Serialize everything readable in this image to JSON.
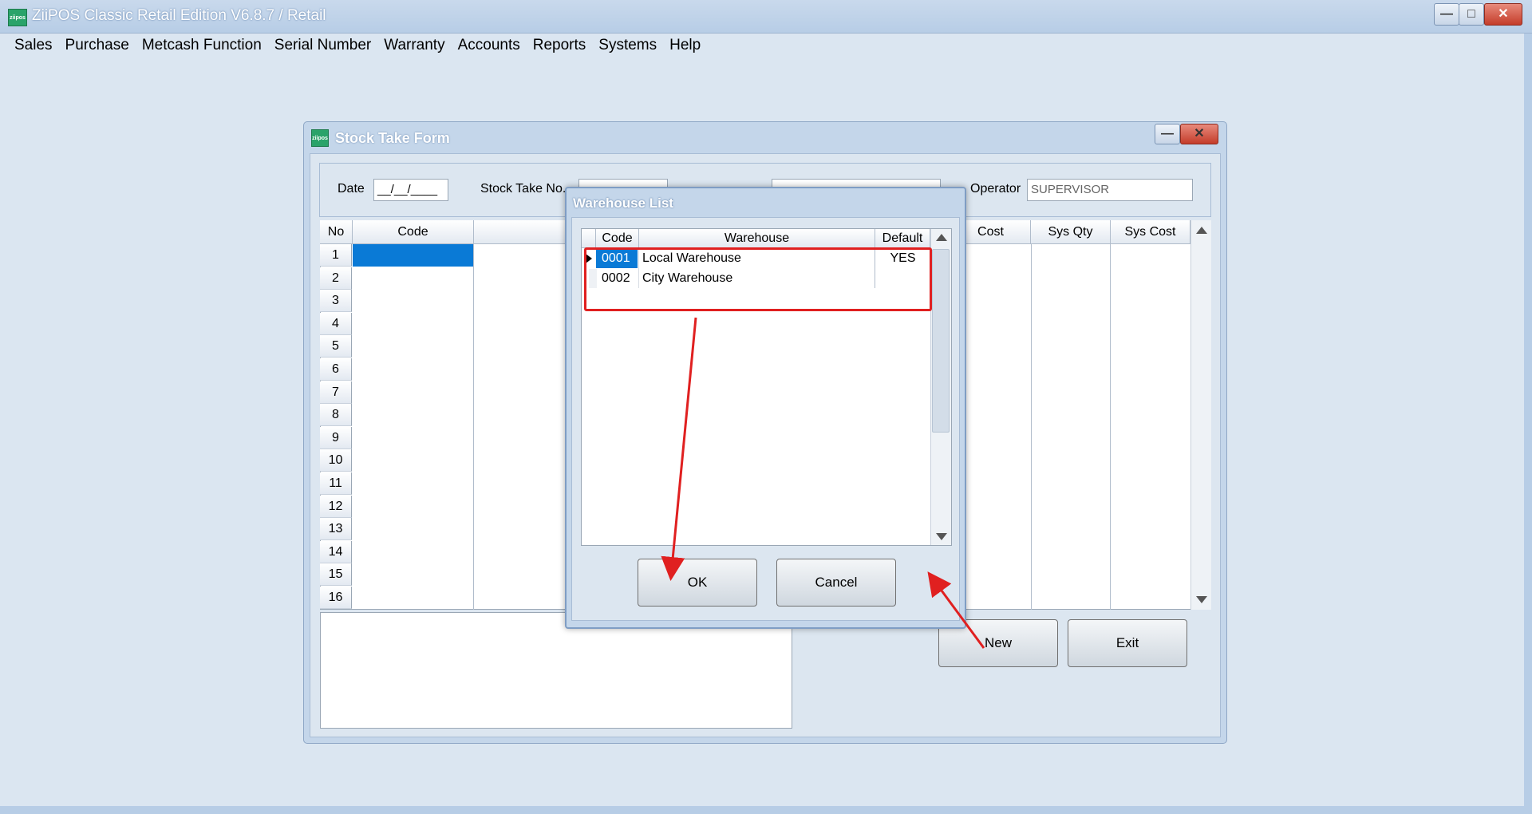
{
  "app": {
    "title": "ZiiPOS Classic Retail Edition V6.8.7 / Retail",
    "logo_text": "ziipos"
  },
  "menu": [
    "Sales",
    "Purchase",
    "Metcash Function",
    "Serial Number",
    "Warranty",
    "Accounts",
    "Reports",
    "Systems",
    "Help"
  ],
  "stock_take_form": {
    "title": "Stock Take Form",
    "date_label": "Date",
    "date_value": "__/__/____",
    "stock_take_no_label": "Stock Take No.",
    "operator_label": "Operator",
    "operator_value": "SUPERVISOR",
    "columns": {
      "no": "No",
      "code": "Code",
      "cost": "Cost",
      "sys_qty": "Sys Qty",
      "sys_cost": "Sys Cost"
    },
    "row_numbers": [
      "1",
      "2",
      "3",
      "4",
      "5",
      "6",
      "7",
      "8",
      "9",
      "10",
      "11",
      "12",
      "13",
      "14",
      "15",
      "16"
    ],
    "new_label": "New",
    "exit_label": "Exit"
  },
  "warehouse_list": {
    "title": "Warehouse List",
    "columns": {
      "code": "Code",
      "warehouse": "Warehouse",
      "default": "Default"
    },
    "rows": [
      {
        "code": "0001",
        "warehouse": "Local Warehouse",
        "default": "YES"
      },
      {
        "code": "0002",
        "warehouse": "City Warehouse",
        "default": ""
      }
    ],
    "ok_label": "OK",
    "cancel_label": "Cancel"
  },
  "colors": {
    "selection": "#0a7ad6",
    "annotation": "#e02020",
    "title_bar": "#b7cde6"
  }
}
